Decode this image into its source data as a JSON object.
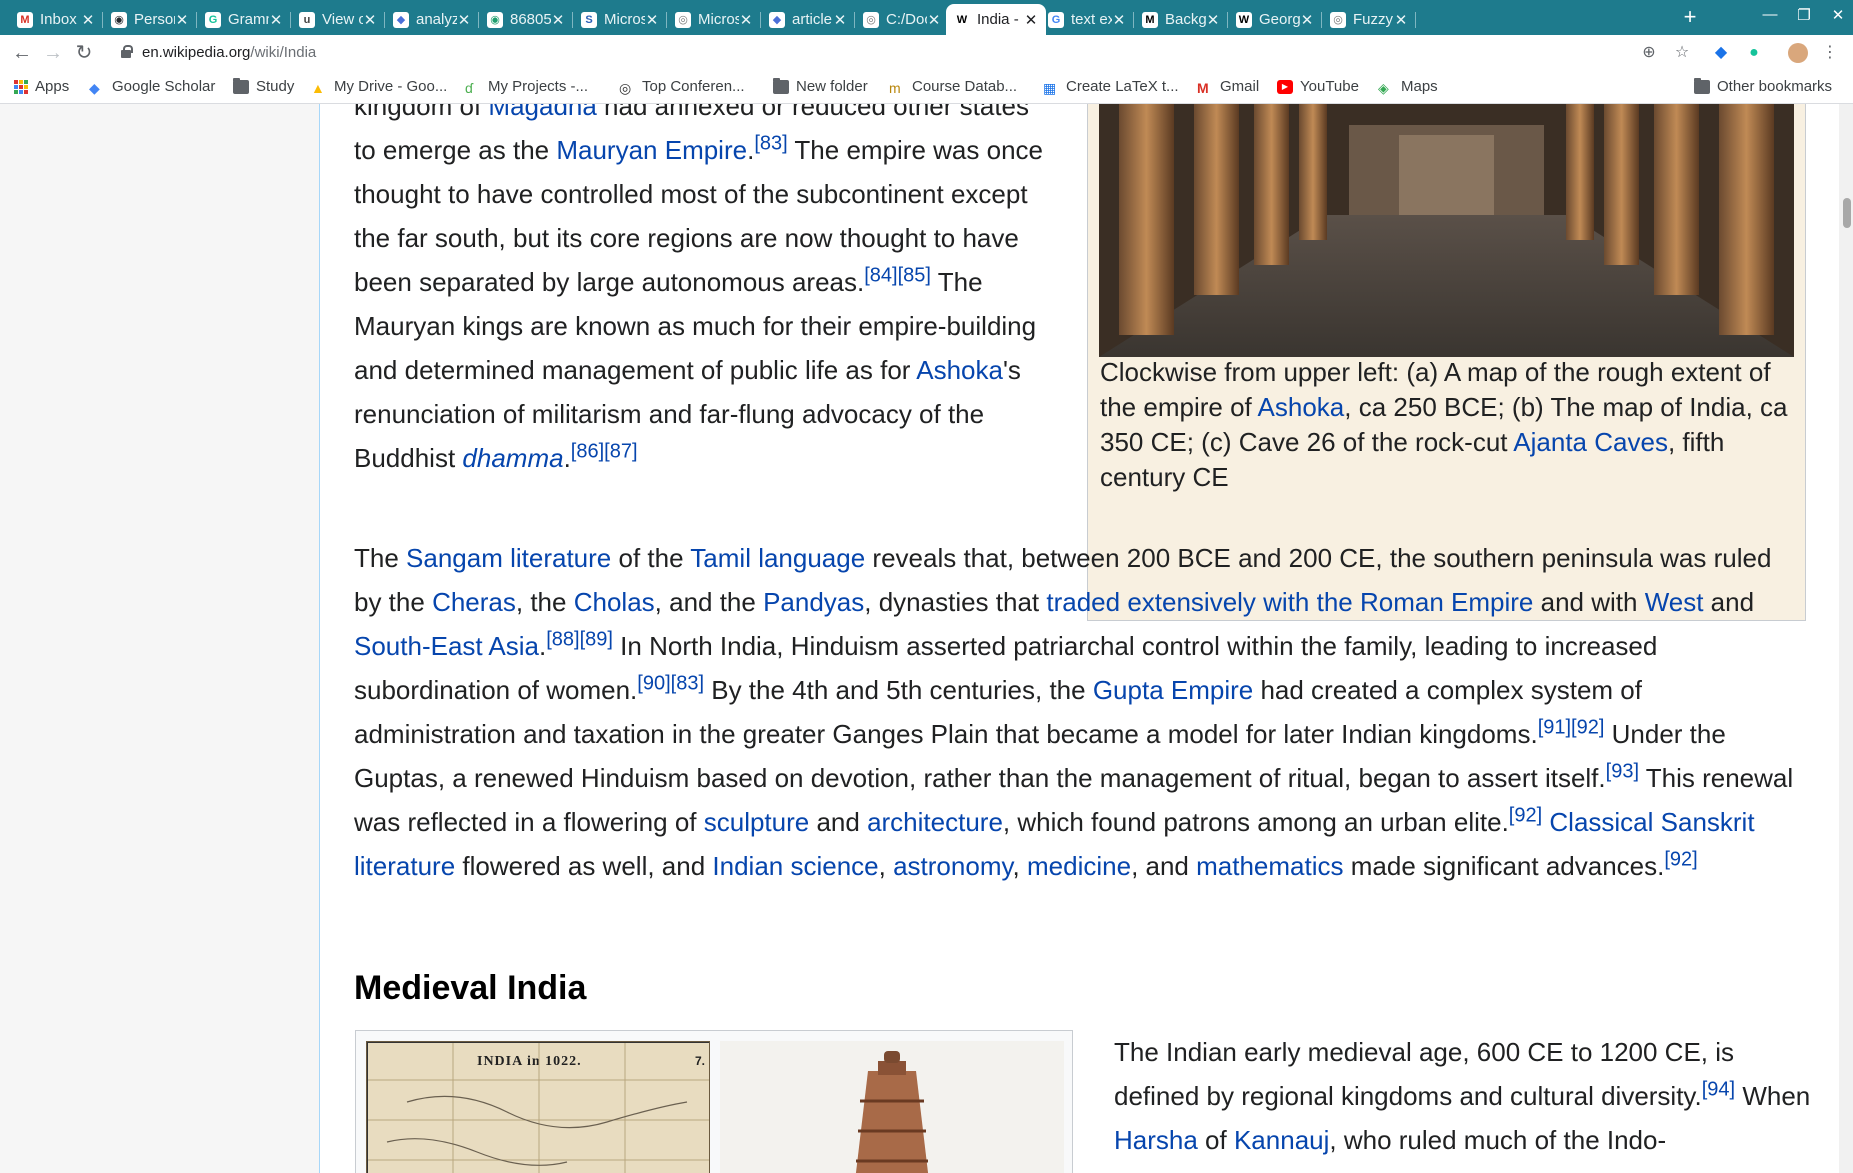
{
  "browser": {
    "tabs": [
      {
        "title": "Inbox (",
        "icon": "gmail-icon",
        "color": "#d93025",
        "glyph": "M"
      },
      {
        "title": "Person",
        "icon": "github-icon",
        "color": "#24292e",
        "glyph": "◉"
      },
      {
        "title": "Gramm",
        "icon": "grammarly-icon",
        "color": "#15c39a",
        "glyph": "G"
      },
      {
        "title": "View o",
        "icon": "overleaf-icon",
        "color": "#444",
        "glyph": "u"
      },
      {
        "title": "analyz",
        "icon": "extension-icon",
        "color": "#4a6fd8",
        "glyph": "◆"
      },
      {
        "title": "86805",
        "icon": "github-icon",
        "color": "#1e9e6e",
        "glyph": "◉"
      },
      {
        "title": "Micros",
        "icon": "microsoft-icon",
        "color": "#2b5fb7",
        "glyph": "S"
      },
      {
        "title": "Micros",
        "icon": "globe-icon",
        "color": "#777",
        "glyph": "◎"
      },
      {
        "title": "article",
        "icon": "extension-icon",
        "color": "#4a6fd8",
        "glyph": "◆"
      },
      {
        "title": "C:/Doc",
        "icon": "globe-icon",
        "color": "#777",
        "glyph": "◎"
      },
      {
        "title": "India -",
        "icon": "wikipedia-icon",
        "color": "#000",
        "glyph": "W",
        "active": true
      },
      {
        "title": "text ex",
        "icon": "google-icon",
        "color": "#4285f4",
        "glyph": "G"
      },
      {
        "title": "Backgr",
        "icon": "medium-icon",
        "color": "#000",
        "glyph": "M"
      },
      {
        "title": "Georgi",
        "icon": "wikipedia-icon",
        "color": "#000",
        "glyph": "W"
      },
      {
        "title": "Fuzzy",
        "icon": "globe-icon",
        "color": "#777",
        "glyph": "◎"
      }
    ],
    "url_host": "en.wikipedia.org",
    "url_path": "/wiki/India"
  },
  "bookmarks": {
    "items": [
      "Apps",
      "Google Scholar",
      "Study",
      "My Drive - Goo...",
      "My Projects -...",
      "Top Conferen...",
      "New folder",
      "Course Datab...",
      "Create LaTeX t...",
      "Gmail",
      "YouTube",
      "Maps"
    ],
    "other": "Other bookmarks"
  },
  "article": {
    "top_para": {
      "t1": "kingdom of ",
      "l1": "Magadha",
      "t2": " had annexed or reduced other states to emerge as the ",
      "l2": "Mauryan Empire",
      "t3": ".",
      "r1": "[83]",
      "t4": " The empire was once thought to have controlled most of the subcontinent except the far south, but its core regions are now thought to have been separated by large autonomous areas.",
      "r2": "[84]",
      "r3": "[85]",
      "t5": " The Mauryan kings are known as much for their empire-building and determined management of public life as for ",
      "l3": "Ashoka",
      "t6": "'s renunciation of militarism and far-flung advocacy of the Buddhist ",
      "l4": "dhamma",
      "t7": ".",
      "r4": "[86]",
      "r5": "[87]"
    },
    "caption": {
      "t1": "Clockwise from upper left: (a) A map of the rough extent of the empire of ",
      "l1": "Ashoka",
      "t2": ", ca 250 BCE; (b) The map of India, ca 350 CE; (c) Cave 26 of the rock-cut ",
      "l2": "Ajanta Caves",
      "t3": ", fifth century CE"
    },
    "main_para": {
      "t1": "The ",
      "l1": "Sangam literature",
      "t2": " of the ",
      "l2": "Tamil language",
      "t3": " reveals that, between 200 BCE and 200 CE, the southern peninsula was ruled by the ",
      "l3": "Cheras",
      "t4": ", the ",
      "l4": "Cholas",
      "t5": ", and the ",
      "l5": "Pandyas",
      "t6": ", dynasties that ",
      "l6": "traded extensively with the Roman Empire",
      "t7": " and with ",
      "l7": "West",
      "t8": " and ",
      "l8": "South-East Asia",
      "t9": ".",
      "r1": "[88]",
      "r2": "[89]",
      "t10": " In North India, Hinduism asserted patriarchal control within the family, leading to increased subordination of women.",
      "r3": "[90]",
      "r4": "[83]",
      "t11": " By the 4th and 5th centuries, the ",
      "l9": "Gupta Empire",
      "t12": " had created a complex system of administration and taxation in the greater Ganges Plain that became a model for later Indian kingdoms.",
      "r5": "[91]",
      "r6": "[92]",
      "t13": " Under the Guptas, a renewed Hinduism based on devotion, rather than the management of ritual, began to assert itself.",
      "r7": "[93]",
      "t14": " This renewal was reflected in a flowering of ",
      "l10": "sculpture",
      "t15": " and ",
      "l11": "architecture",
      "t16": ", which found patrons among an urban elite.",
      "r8": "[92]",
      "t17": " ",
      "l12": "Classical Sanskrit literature",
      "t18": " flowered as well, and ",
      "l13": "Indian science",
      "t19": ", ",
      "l14": "astronomy",
      "t20": ", ",
      "l15": "medicine",
      "t21": ", and ",
      "l16": "mathematics",
      "t22": " made significant advances.",
      "r9": "[92]"
    },
    "heading_medieval": "Medieval India",
    "map_label": "INDIA in 1022.",
    "map_number": "7.",
    "medieval_para": {
      "t1": "The Indian early medieval age, 600 CE to 1200 CE, is defined by regional kingdoms and cultural diversity.",
      "r1": "[94]",
      "t2": " When ",
      "l1": "Harsha",
      "t3": " of ",
      "l2": "Kannauj",
      "t4": ", who ruled much of the Indo-"
    }
  }
}
